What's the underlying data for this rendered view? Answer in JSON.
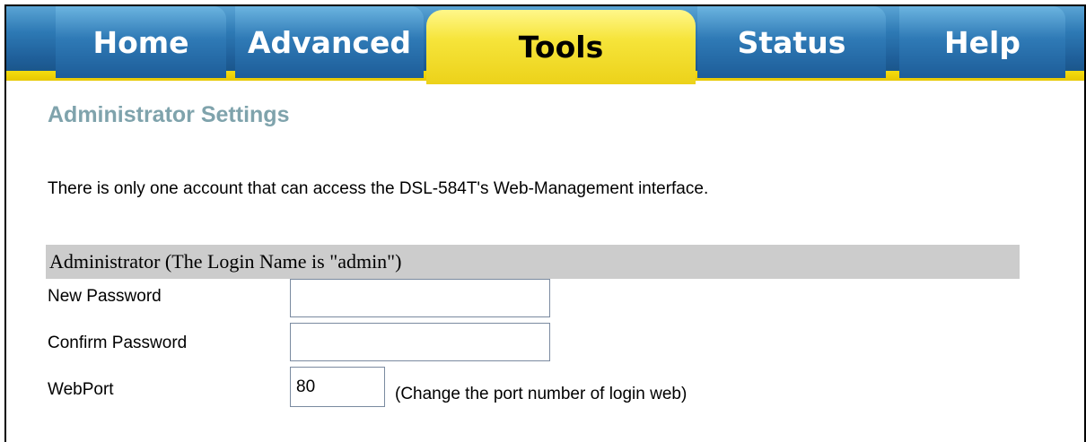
{
  "nav": {
    "tabs": [
      {
        "label": "Home"
      },
      {
        "label": "Advanced"
      },
      {
        "label": "Tools"
      },
      {
        "label": "Status"
      },
      {
        "label": "Help"
      }
    ],
    "active_tab": "Tools"
  },
  "page": {
    "title": "Administrator Settings",
    "description": "There is only one account that can access the DSL-584T's Web-Management interface."
  },
  "admin_section": {
    "header": "Administrator (The Login Name is \"admin\")",
    "new_password_label": "New Password",
    "new_password_value": "",
    "confirm_password_label": "Confirm Password",
    "confirm_password_value": "",
    "webport_label": "WebPort",
    "webport_value": "80",
    "webport_hint": "(Change the port number of login web)"
  },
  "colors": {
    "tab_blue": "#2d79b4",
    "tab_active_yellow": "#f6e43a",
    "title_color": "#7fa3ac",
    "section_bar": "#cccccc"
  }
}
